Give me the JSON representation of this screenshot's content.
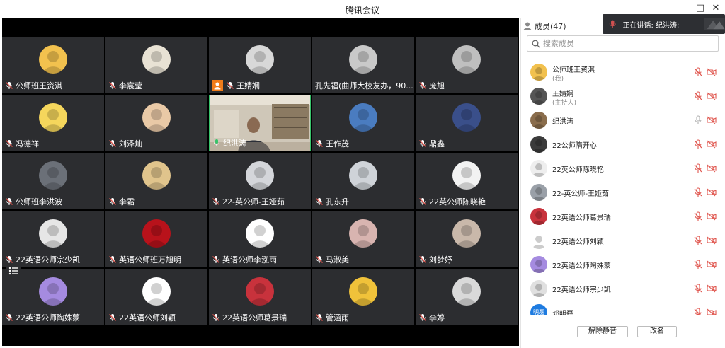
{
  "window": {
    "title": "腾讯会议"
  },
  "speaking": {
    "text": "正在讲话: 纪洪涛;"
  },
  "panel": {
    "header": "成员(47)",
    "search_placeholder": "搜索成员",
    "unmute_label": "解除静音",
    "rename_label": "改名"
  },
  "tiles": [
    {
      "name": "公师班王资淇",
      "avatar": "#f2c14e",
      "host": false,
      "speaker": false
    },
    {
      "name": "李宸莹",
      "avatar": "#e8e2d4",
      "host": false,
      "speaker": false
    },
    {
      "name": "王婧娴",
      "avatar": "#d8d8d8",
      "host": true,
      "speaker": false
    },
    {
      "name": "孔先福(曲师大校友办，90...",
      "avatar": "#c9c9c9",
      "host": false,
      "speaker": false
    },
    {
      "name": "庞旭",
      "avatar": "#bfbfbf",
      "host": false,
      "speaker": false
    },
    {
      "name": "冯德祥",
      "avatar": "#f5d65c",
      "host": false,
      "speaker": false
    },
    {
      "name": "刘泽灿",
      "avatar": "#e9c9a6",
      "host": false,
      "speaker": false
    },
    {
      "name": "纪洪涛",
      "avatar": "#7b6a55",
      "host": false,
      "speaker": true
    },
    {
      "name": "王作茂",
      "avatar": "#4a7cc0",
      "host": false,
      "speaker": false
    },
    {
      "name": "鼎鑫",
      "avatar": "#3a4f8a",
      "host": false,
      "speaker": false
    },
    {
      "name": "公师班李洪波",
      "avatar": "#6b7078",
      "host": false,
      "speaker": false
    },
    {
      "name": "李霜",
      "avatar": "#e0c48c",
      "host": false,
      "speaker": false
    },
    {
      "name": "22-英公师-王娅茹",
      "avatar": "#d4d6da",
      "host": false,
      "speaker": false
    },
    {
      "name": "孔东升",
      "avatar": "#cfd3d8",
      "host": false,
      "speaker": false
    },
    {
      "name": "22英公师陈晓艳",
      "avatar": "#f2f2f2",
      "host": false,
      "speaker": false
    },
    {
      "name": "22英语公师宗少凯",
      "avatar": "#e6e6e6",
      "host": false,
      "speaker": false
    },
    {
      "name": "英语公师班万旭明",
      "avatar": "#b8121b",
      "host": false,
      "speaker": false
    },
    {
      "name": "英语公师李泓雨",
      "avatar": "#ffffff",
      "host": false,
      "speaker": false
    },
    {
      "name": "马淑美",
      "avatar": "#d8b4b0",
      "host": false,
      "speaker": false
    },
    {
      "name": "刘梦妤",
      "avatar": "#c9b8aa",
      "host": false,
      "speaker": false
    },
    {
      "name": "22英语公师陶姝蒙",
      "avatar": "#a58be0",
      "host": false,
      "speaker": false
    },
    {
      "name": "22英语公师刘颖",
      "avatar": "#ffffff",
      "host": false,
      "speaker": false
    },
    {
      "name": "22英语公师葛景瑞",
      "avatar": "#c8323c",
      "host": false,
      "speaker": false
    },
    {
      "name": "管涵雨",
      "avatar": "#f0c23a",
      "host": false,
      "speaker": false
    },
    {
      "name": "李婷",
      "avatar": "#d9d9d9",
      "host": false,
      "speaker": false
    }
  ],
  "members": [
    {
      "name": "公师班王资淇",
      "sub": "(我)",
      "avatar": "#f2c14e",
      "muted": true
    },
    {
      "name": "王婧娴",
      "sub": "(主持人)",
      "avatar": "#555555",
      "muted": true
    },
    {
      "name": "纪洪涛",
      "sub": "",
      "avatar": "#8a6d4c",
      "muted": false
    },
    {
      "name": "22公师隋开心",
      "sub": "",
      "avatar": "#3b3b3b",
      "muted": true
    },
    {
      "name": "22英公师陈晓艳",
      "sub": "",
      "avatar": "#eeeeee",
      "muted": true
    },
    {
      "name": "22-英公师-王娅茹",
      "sub": "",
      "avatar": "#9aa0a8",
      "muted": true
    },
    {
      "name": "22英语公师葛景瑞",
      "sub": "",
      "avatar": "#c8323c",
      "muted": true
    },
    {
      "name": "22英语公师刘颖",
      "sub": "",
      "avatar": "#ffffff",
      "muted": true
    },
    {
      "name": "22英语公师陶姝蒙",
      "sub": "",
      "avatar": "#a58be0",
      "muted": true
    },
    {
      "name": "22英语公师宗少凯",
      "sub": "",
      "avatar": "#e0e0e0",
      "muted": true
    },
    {
      "name": "邓明磊",
      "sub": "",
      "avatar": "#1e7be0",
      "muted": true,
      "initials": "明磊"
    }
  ],
  "colors": {
    "muted_red": "#e0574f",
    "cam_off_red": "#e0574f",
    "mic_on_gray": "#b0b0b0",
    "speaker_green": "#37c36a",
    "host_orange": "#f07c1a"
  }
}
